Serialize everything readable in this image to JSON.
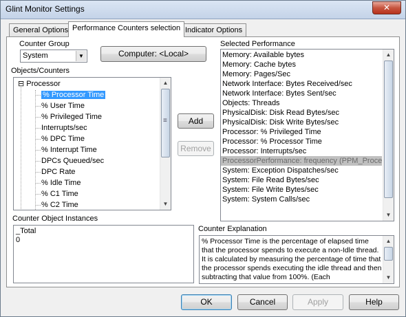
{
  "window": {
    "title": "Glint Monitor Settings",
    "close_glyph": "✕"
  },
  "tabs": [
    {
      "label": "General Options"
    },
    {
      "label": "Performance Counters selection"
    },
    {
      "label": "Indicator Options"
    }
  ],
  "counter_group": {
    "label": "Counter Group",
    "value": "System"
  },
  "computer_button": {
    "label": "Computer: <Local>"
  },
  "objects_counters": {
    "label": "Objects/Counters",
    "expander": "⊟",
    "root": "Processor",
    "items": [
      "% Processor Time",
      "% User Time",
      "% Privileged Time",
      "Interrupts/sec",
      "% DPC Time",
      "% Interrupt Time",
      "DPCs Queued/sec",
      "DPC Rate",
      "% Idle Time",
      "% C1 Time",
      "% C2 Time"
    ]
  },
  "add_button": {
    "label": "Add"
  },
  "remove_button": {
    "label": "Remove"
  },
  "selected_performance": {
    "label": "Selected Performance",
    "items": [
      "Memory: Available bytes",
      "Memory: Cache bytes",
      "Memory: Pages/Sec",
      "Network Interface: Bytes Received/sec",
      "Network Interface: Bytes Sent/sec",
      "Objects: Threads",
      "PhysicalDisk: Disk Read Bytes/sec",
      "PhysicalDisk: Disk Write Bytes/sec",
      "Processor: % Privileged Time",
      "Processor: % Processor Time",
      "Processor: Interrupts/sec",
      "ProcessorPerformance: frequency (PPM_Processor_",
      "System: Exception Dispatches/sec",
      "System: File Read Bytes/sec",
      "System: File Write Bytes/sec",
      "System: System Calls/sec"
    ]
  },
  "instances": {
    "label": "Counter Object Instances",
    "items": [
      "_Total",
      "0"
    ]
  },
  "explanation": {
    "label": "Counter Explanation",
    "text": "% Processor Time is the percentage of elapsed time that the processor spends to execute a non-Idle thread. It is calculated by measuring the percentage of time that the processor spends executing the idle thread and then subtracting that value from 100%. (Each"
  },
  "footer": {
    "ok": "OK",
    "cancel": "Cancel",
    "apply": "Apply",
    "help": "Help"
  },
  "scroll_glyphs": {
    "up": "▲",
    "down": "▼",
    "grip": "≡",
    "dropdown": "▼"
  }
}
